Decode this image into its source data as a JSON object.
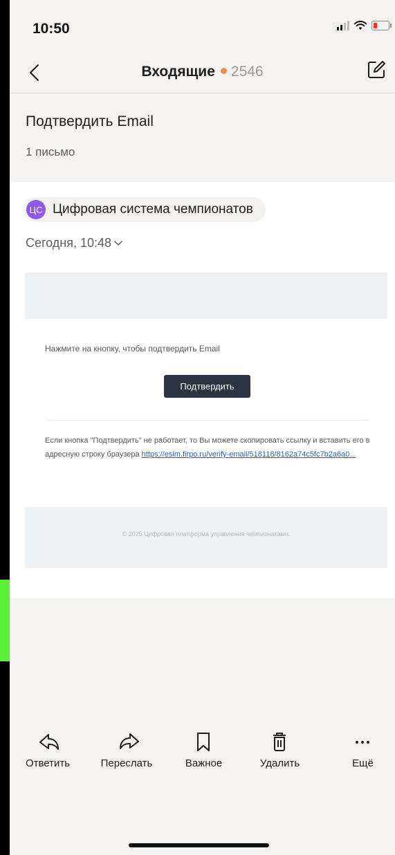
{
  "status_bar": {
    "time": "10:50"
  },
  "nav": {
    "title": "Входящие",
    "unread_count": "2546",
    "dot_color": "#f08a4b"
  },
  "thread": {
    "subject": "Подтвердить Email",
    "count": "1 письмо"
  },
  "message": {
    "sender_initials": "ЦС",
    "sender_name": "Цифровая система чемпионатов",
    "avatar_color": "#8e58e8",
    "date": "Сегодня, 10:48",
    "body": {
      "instruction": "Нажмите на кнопку, чтобы подтвердить Email",
      "confirm_label": "Подтвердить",
      "fallback_text": "Если кнопка \"Подтвердить\" не работает, то Вы можете скопировать ссылку и вставить его в адресную строку браузера ",
      "link_text": "https://esim.firpo.ru/verify-email/518118/8162a74c5fc7b2a6a0...",
      "copyright": "© 2025 Цифровая платформа управления чемпионатами."
    }
  },
  "toolbar": {
    "reply_label": "Ответить",
    "forward_label": "Переслать",
    "important_label": "Важное",
    "delete_label": "Удалить",
    "more_label": "Ещё"
  }
}
